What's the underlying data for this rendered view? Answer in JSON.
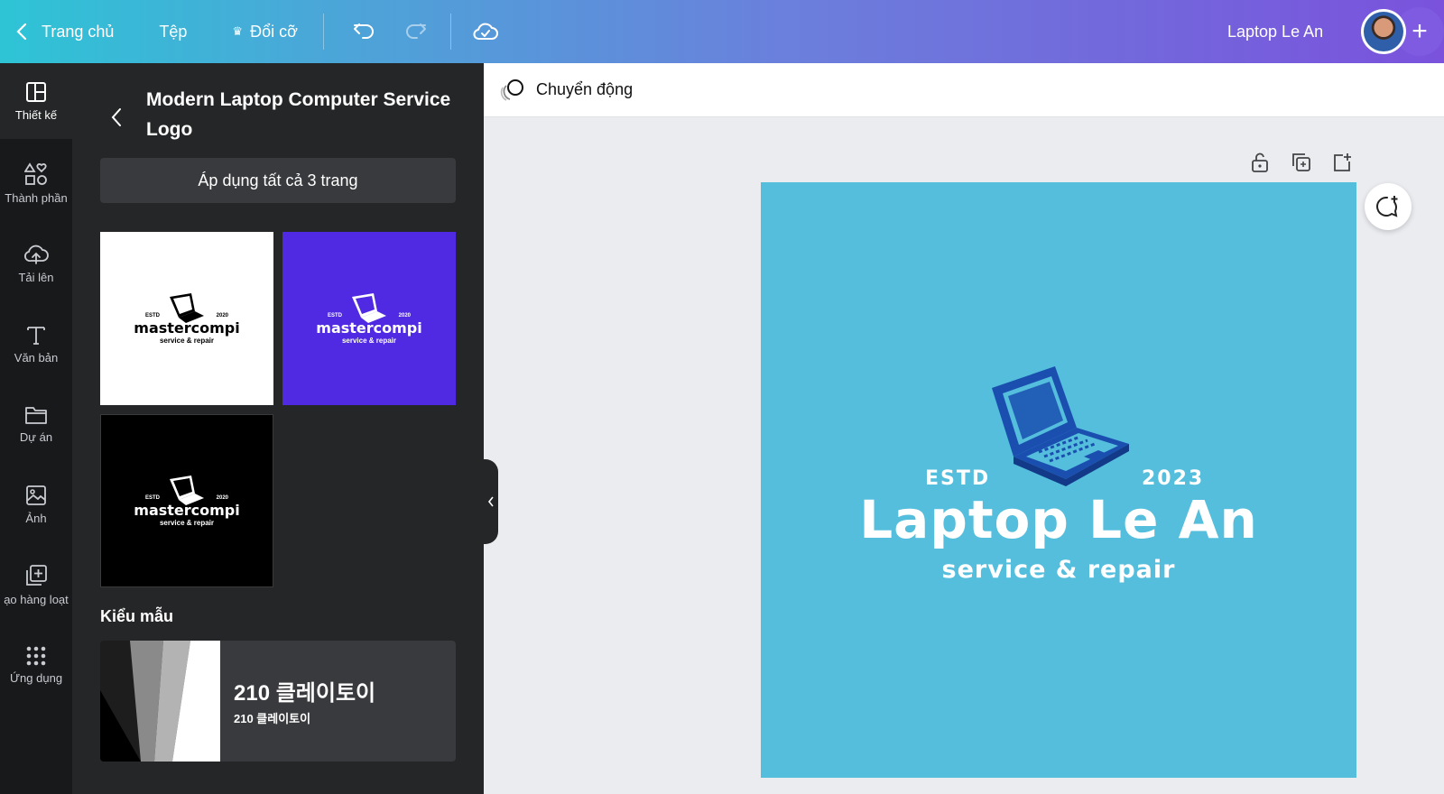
{
  "topbar": {
    "home_label": "Trang chủ",
    "file_label": "Tệp",
    "resize_label": "Đổi cỡ",
    "design_title": "Laptop Le An"
  },
  "rail": {
    "items": [
      {
        "label": "Thiết kế",
        "icon": "layout-icon"
      },
      {
        "label": "Thành phần",
        "icon": "shapes-icon"
      },
      {
        "label": "Tải lên",
        "icon": "cloud-upload-icon"
      },
      {
        "label": "Văn bản",
        "icon": "text-icon"
      },
      {
        "label": "Dự án",
        "icon": "folder-icon"
      },
      {
        "label": "Ảnh",
        "icon": "image-icon"
      },
      {
        "label": "ạo hàng loạt",
        "icon": "bulk-create-icon"
      },
      {
        "label": "Ứng dụng",
        "icon": "apps-grid-icon"
      }
    ]
  },
  "panel": {
    "title": "Modern Laptop Computer Service Logo",
    "apply_label": "Áp dụng tất cả 3 trang",
    "thumbnails": [
      {
        "estd": "ESTD",
        "year": "2020",
        "brand": "mastercompi",
        "sub": "service & repair",
        "bg": "#ffffff"
      },
      {
        "estd": "ESTD",
        "year": "2020",
        "brand": "mastercompi",
        "sub": "service & repair",
        "bg": "#5029e2"
      },
      {
        "estd": "ESTD",
        "year": "2020",
        "brand": "mastercompi",
        "sub": "service & repair",
        "bg": "#000000"
      }
    ],
    "styles_label": "Kiểu mẫu",
    "style_card": {
      "big": "210 클레이토이",
      "small": "210 클레이토이"
    }
  },
  "canvas": {
    "animate_label": "Chuyển động",
    "design": {
      "bg": "#54bedc",
      "estd": "ESTD",
      "year": "2023",
      "brand": "Laptop Le An",
      "sub": "service & repair",
      "icon_color": "#1a4fb0"
    }
  }
}
